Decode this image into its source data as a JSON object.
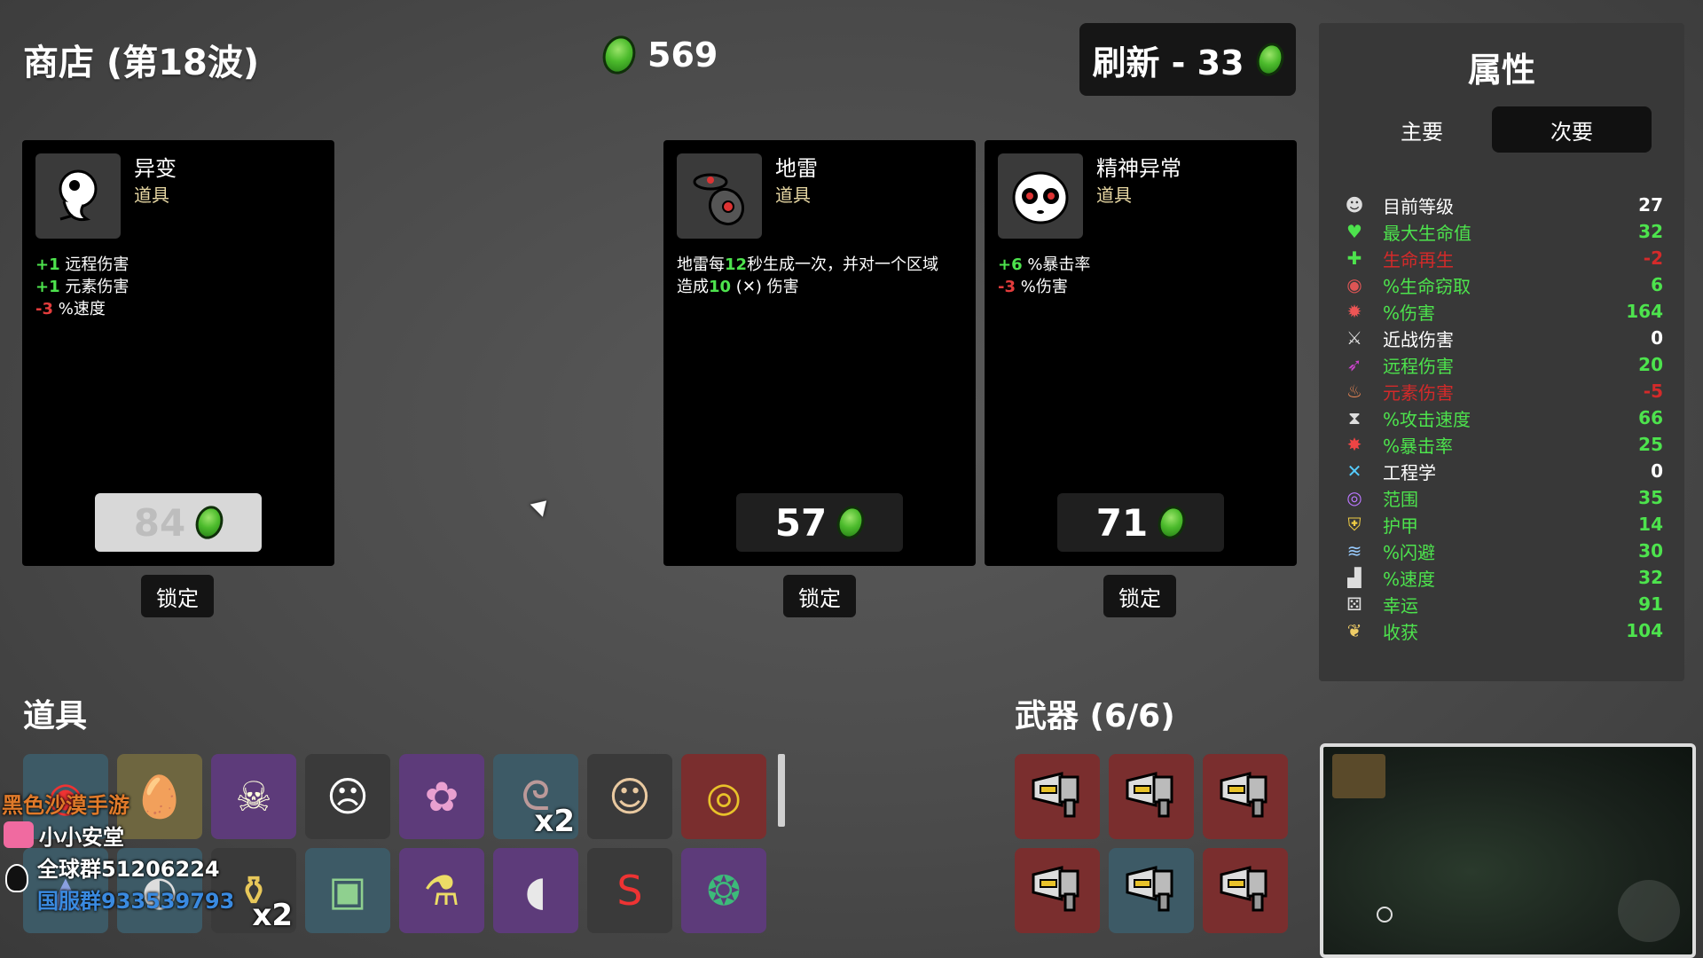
{
  "header": {
    "title": "商店 (第18波)",
    "gold": "569",
    "reroll_label": "刷新 - 33"
  },
  "shop": {
    "cards": [
      {
        "name": "异变",
        "type": "道具",
        "icon": "ghost-creature-icon",
        "desc_lines": [
          {
            "prefix": "+1",
            "prefix_color": "green",
            "text": " 远程伤害"
          },
          {
            "prefix": "+1",
            "prefix_color": "green",
            "text": " 元素伤害"
          },
          {
            "prefix": "-3",
            "prefix_color": "red",
            "text": " %速度"
          }
        ],
        "price": "84",
        "price_affordable": false,
        "lock_label": "锁定"
      },
      {
        "name": "地雷",
        "type": "道具",
        "icon": "landmine-icon",
        "desc_text_1": "地雷每",
        "desc_num_1": "12",
        "desc_text_2": "秒生成一次，并对一个区域",
        "desc_text_3": "造成",
        "desc_num_2": "10",
        "desc_text_4": " (",
        "desc_symbol": "✕",
        "desc_text_5": ") 伤害",
        "price": "57",
        "price_affordable": true,
        "lock_label": "锁定"
      },
      {
        "name": "精神异常",
        "type": "道具",
        "icon": "skull-face-icon",
        "desc_lines": [
          {
            "prefix": "+6",
            "prefix_color": "green",
            "text": " %暴击率"
          },
          {
            "prefix": "-3",
            "prefix_color": "red",
            "text": " %伤害"
          }
        ],
        "price": "71",
        "price_affordable": true,
        "lock_label": "锁定"
      }
    ]
  },
  "stats_panel": {
    "title": "属性",
    "tabs": [
      {
        "label": "主要",
        "active": false
      },
      {
        "label": "次要",
        "active": true
      }
    ],
    "rows": [
      {
        "icon": "level-icon",
        "label": "目前等级",
        "value": "27",
        "color": "#ffffff"
      },
      {
        "icon": "heart-icon",
        "label": "最大生命值",
        "value": "32",
        "color": "#4de34d"
      },
      {
        "icon": "regen-icon",
        "label": "生命再生",
        "value": "-2",
        "color": "#d42a2a"
      },
      {
        "icon": "lifesteal-icon",
        "label": "%生命窃取",
        "value": "6",
        "color": "#4de34d"
      },
      {
        "icon": "damage-icon",
        "label": "%伤害",
        "value": "164",
        "color": "#4de34d"
      },
      {
        "icon": "sword-icon",
        "label": "近战伤害",
        "value": "0",
        "color": "#ffffff"
      },
      {
        "icon": "bow-icon",
        "label": "远程伤害",
        "value": "20",
        "color": "#4de34d"
      },
      {
        "icon": "flame-icon",
        "label": "元素伤害",
        "value": "-5",
        "color": "#d42a2a"
      },
      {
        "icon": "hourglass-icon",
        "label": "%攻击速度",
        "value": "66",
        "color": "#4de34d"
      },
      {
        "icon": "crit-icon",
        "label": "%暴击率",
        "value": "25",
        "color": "#4de34d"
      },
      {
        "icon": "wrench-icon",
        "label": "工程学",
        "value": "0",
        "color": "#ffffff"
      },
      {
        "icon": "range-icon",
        "label": "范围",
        "value": "35",
        "color": "#4de34d"
      },
      {
        "icon": "shield-icon",
        "label": "护甲",
        "value": "14",
        "color": "#4de34d"
      },
      {
        "icon": "dodge-icon",
        "label": "%闪避",
        "value": "30",
        "color": "#4de34d"
      },
      {
        "icon": "boot-icon",
        "label": "%速度",
        "value": "32",
        "color": "#4de34d"
      },
      {
        "icon": "dice-icon",
        "label": "幸运",
        "value": "91",
        "color": "#4de34d"
      },
      {
        "icon": "harvest-icon",
        "label": "收获",
        "value": "104",
        "color": "#4de34d"
      }
    ]
  },
  "inventory": {
    "items_title": "道具",
    "weapons_title": "武器 (6/6)",
    "items": [
      {
        "icon": "red-eye-icon",
        "tier": "blue",
        "badge": ""
      },
      {
        "icon": "egg-icon",
        "tier": "tan",
        "badge": ""
      },
      {
        "icon": "running-creature-icon",
        "tier": "purple",
        "badge": ""
      },
      {
        "icon": "bandaged-head-icon",
        "tier": "gray",
        "badge": ""
      },
      {
        "icon": "brain-icon",
        "tier": "purple",
        "badge": ""
      },
      {
        "icon": "tentacle-icon",
        "tier": "blue",
        "badge": "x2"
      },
      {
        "icon": "scared-face-icon",
        "tier": "gray",
        "badge": ""
      },
      {
        "icon": "gold-coin-icon",
        "tier": "red",
        "badge": ""
      },
      {
        "icon": "wizard-hat-icon",
        "tier": "blue",
        "badge": ""
      },
      {
        "icon": "glasses-icon",
        "tier": "blue",
        "badge": ""
      },
      {
        "icon": "honey-pot-icon",
        "tier": "gray",
        "badge": "x2"
      },
      {
        "icon": "turret-icon",
        "tier": "blue",
        "badge": ""
      },
      {
        "icon": "potion-lab-icon",
        "tier": "purple",
        "badge": ""
      },
      {
        "icon": "mouse-icon",
        "tier": "purple",
        "badge": ""
      },
      {
        "icon": "red-snake-icon",
        "tier": "gray",
        "badge": ""
      },
      {
        "icon": "peacock-icon",
        "tier": "purple",
        "badge": ""
      }
    ],
    "weapons": [
      {
        "icon": "megaphone-gun-icon",
        "tier": "red"
      },
      {
        "icon": "megaphone-gun-icon",
        "tier": "red"
      },
      {
        "icon": "megaphone-gun-icon",
        "tier": "red"
      },
      {
        "icon": "megaphone-gun-icon",
        "tier": "red"
      },
      {
        "icon": "megaphone-gun-icon",
        "tier": "blue"
      },
      {
        "icon": "megaphone-gun-icon",
        "tier": "red"
      }
    ]
  },
  "stream_overlay": {
    "line1": "黑色沙漠手游",
    "line2": "小小安堂",
    "line3": "全球群51206224",
    "line4": "国服群933539793"
  },
  "colors": {
    "coin_green": "#4cbb2c",
    "stat_green": "#4de34d",
    "stat_red": "#d42a2a",
    "item_type": "#e9d9a4",
    "overlay_orange": "#e07a2a",
    "overlay_blue": "#3a8ae0"
  }
}
